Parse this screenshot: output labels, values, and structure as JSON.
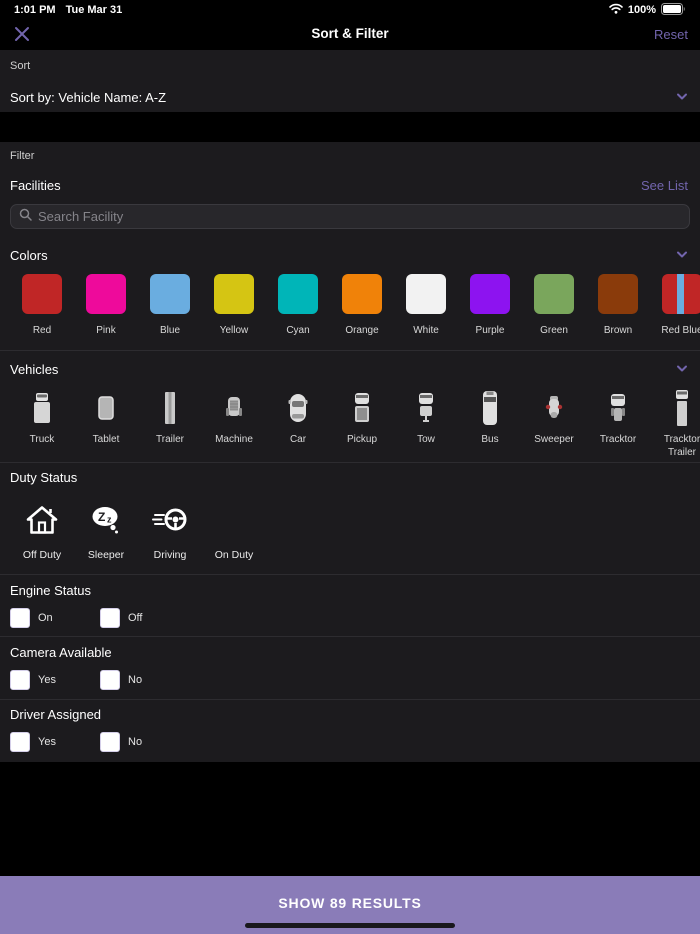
{
  "theme": {
    "accent_purple": "#7265ad",
    "footer_purple": "#8a7cb8",
    "section_bg": "#1c1b1e",
    "page_bg": "#000000"
  },
  "status_bar": {
    "time": "1:01 PM",
    "date": "Tue Mar 31",
    "battery": "100%"
  },
  "header": {
    "title": "Sort & Filter",
    "reset_label": "Reset"
  },
  "sort": {
    "section_label": "Sort",
    "value": "Sort by: Vehicle Name: A-Z"
  },
  "filter": {
    "section_label": "Filter",
    "facilities": {
      "label": "Facilities",
      "see_list_label": "See List",
      "search_placeholder": "Search Facility"
    },
    "colors": {
      "label": "Colors",
      "items": [
        {
          "name": "Red",
          "color": "#c02626"
        },
        {
          "name": "Pink",
          "color": "#ee0a9b"
        },
        {
          "name": "Blue",
          "color": "#6aade0"
        },
        {
          "name": "Yellow",
          "color": "#d5c513"
        },
        {
          "name": "Cyan",
          "color": "#00b5b8"
        },
        {
          "name": "Orange",
          "color": "#f08209"
        },
        {
          "name": "White",
          "color": "#f2f2f2"
        },
        {
          "name": "Purple",
          "color": "#8d13f0"
        },
        {
          "name": "Green",
          "color": "#7aa65c"
        },
        {
          "name": "Brown",
          "color": "#8a3b0b"
        },
        {
          "name": "Red Blue",
          "color": "#c02626",
          "stripe": "#6aade0"
        }
      ]
    },
    "vehicles": {
      "label": "Vehicles",
      "items": [
        {
          "label": "Truck",
          "icon": "truck-icon"
        },
        {
          "label": "Tablet",
          "icon": "tablet-icon"
        },
        {
          "label": "Trailer",
          "icon": "trailer-icon"
        },
        {
          "label": "Machine",
          "icon": "machine-icon"
        },
        {
          "label": "Car",
          "icon": "car-icon"
        },
        {
          "label": "Pickup",
          "icon": "pickup-icon"
        },
        {
          "label": "Tow",
          "icon": "tow-icon"
        },
        {
          "label": "Bus",
          "icon": "bus-icon"
        },
        {
          "label": "Sweeper",
          "icon": "sweeper-icon"
        },
        {
          "label": "Tracktor",
          "icon": "tracktor-icon"
        },
        {
          "label": "Tracktor Trailer",
          "icon": "tracktor-trailer-icon"
        }
      ]
    },
    "duty_status": {
      "label": "Duty Status",
      "items": [
        {
          "label": "Off Duty",
          "icon": "home-icon"
        },
        {
          "label": "Sleeper",
          "icon": "sleeper-icon"
        },
        {
          "label": "Driving",
          "icon": "steering-wheel-icon"
        },
        {
          "label": "On Duty",
          "icon": null
        }
      ]
    },
    "engine_status": {
      "label": "Engine Status",
      "options": [
        "On",
        "Off"
      ]
    },
    "camera_available": {
      "label": "Camera Available",
      "options": [
        "Yes",
        "No"
      ]
    },
    "driver_assigned": {
      "label": "Driver Assigned",
      "options": [
        "Yes",
        "No"
      ]
    }
  },
  "footer": {
    "button_label": "SHOW 89 RESULTS"
  }
}
